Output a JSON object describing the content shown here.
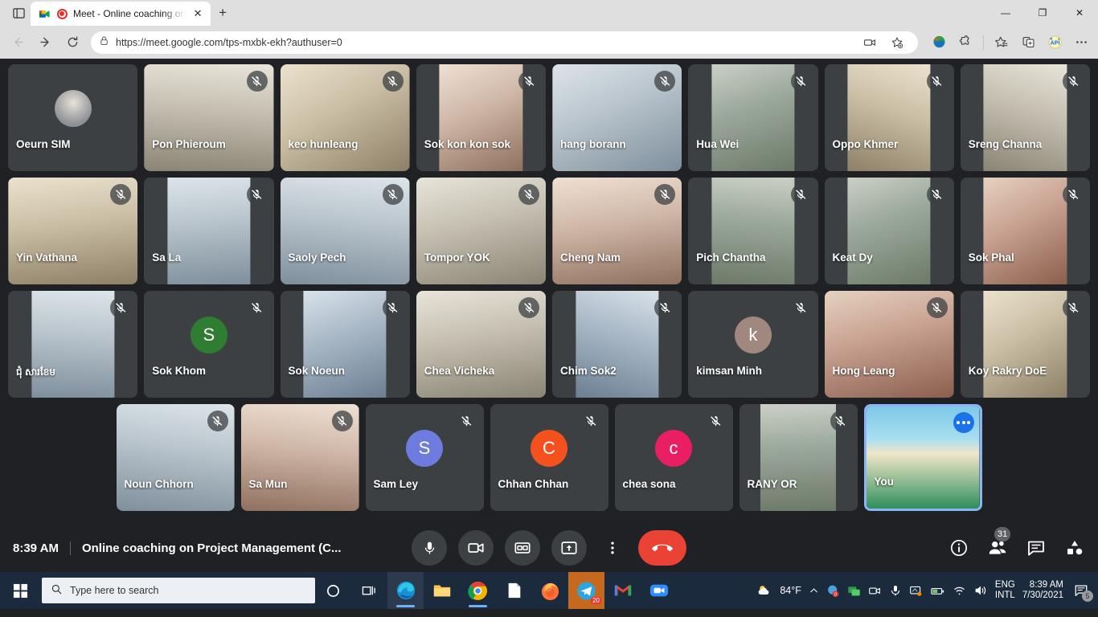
{
  "browser": {
    "tab": {
      "title": "Meet - Online coaching on",
      "favicon": "google-meet-icon",
      "recording": true,
      "close_label": "✕"
    },
    "new_tab_label": "+",
    "window_controls": {
      "minimize": "—",
      "maximize": "❐",
      "close": "✕"
    },
    "url": "https://meet.google.com/tps-mxbk-ekh?authuser=0",
    "nav": {
      "back": "back-icon",
      "forward": "forward-icon",
      "reload": "reload-icon"
    },
    "toolbar_icons": [
      "media-cast-icon",
      "add-favorite-icon",
      "globe-extension-icon",
      "puzzle-extension-icon",
      "collections-icon",
      "split-screen-icon",
      "api-extension-icon",
      "settings-more-icon"
    ]
  },
  "meet": {
    "time": "8:39 AM",
    "title": "Online coaching on Project Management (C...",
    "controls": [
      {
        "name": "microphone-button",
        "icon": "mic-icon"
      },
      {
        "name": "camera-button",
        "icon": "camera-icon"
      },
      {
        "name": "captions-button",
        "icon": "cc-icon"
      },
      {
        "name": "present-button",
        "icon": "present-screen-icon"
      },
      {
        "name": "more-options-button",
        "icon": "kebab-icon"
      },
      {
        "name": "leave-call-button",
        "icon": "hangup-icon"
      }
    ],
    "right_icons": [
      {
        "name": "meeting-details-button",
        "icon": "info-icon"
      },
      {
        "name": "participants-button",
        "icon": "people-icon",
        "badge": "31"
      },
      {
        "name": "chat-button",
        "icon": "chat-icon"
      },
      {
        "name": "activities-button",
        "icon": "activities-icon"
      }
    ],
    "participants": [
      {
        "name": "Oeurn SIM",
        "muted": false,
        "kind": "avatar-photo",
        "av": "#8d9096",
        "fit": ""
      },
      {
        "name": "Pon Phieroum",
        "muted": true,
        "kind": "video",
        "fit": "full"
      },
      {
        "name": "keo hunleang",
        "muted": true,
        "kind": "video",
        "fit": "full"
      },
      {
        "name": "Sok kon kon sok",
        "muted": true,
        "kind": "video",
        "fit": ""
      },
      {
        "name": "hang borann",
        "muted": true,
        "kind": "video",
        "fit": "full"
      },
      {
        "name": "Hua Wei",
        "muted": true,
        "kind": "video",
        "fit": ""
      },
      {
        "name": "Oppo Khmer",
        "muted": true,
        "kind": "video",
        "fit": ""
      },
      {
        "name": "Sreng Channa",
        "muted": true,
        "kind": "video",
        "fit": ""
      },
      {
        "name": "Yin Vathana",
        "muted": true,
        "kind": "video",
        "fit": "full"
      },
      {
        "name": "Sa La",
        "muted": true,
        "kind": "video",
        "fit": ""
      },
      {
        "name": "Saoly Pech",
        "muted": true,
        "kind": "video",
        "fit": "full"
      },
      {
        "name": "Tompor YOK",
        "muted": true,
        "kind": "video",
        "fit": "full"
      },
      {
        "name": "Cheng Nam",
        "muted": true,
        "kind": "video",
        "fit": "full"
      },
      {
        "name": "Pich Chantha",
        "muted": true,
        "kind": "video",
        "fit": ""
      },
      {
        "name": "Keat Dy",
        "muted": true,
        "kind": "video",
        "fit": ""
      },
      {
        "name": "Sok Phal",
        "muted": true,
        "kind": "video",
        "fit": ""
      },
      {
        "name": "ជុំ សារខែម",
        "muted": true,
        "kind": "video",
        "fit": "",
        "khmer": true
      },
      {
        "name": "Sok Khom",
        "muted": true,
        "kind": "avatar-letter",
        "letter": "S",
        "av": "#2e7d32"
      },
      {
        "name": "Sok Noeun",
        "muted": true,
        "kind": "video",
        "fit": ""
      },
      {
        "name": "Chea Vicheka",
        "muted": true,
        "kind": "video",
        "fit": "full"
      },
      {
        "name": "Chim Sok2",
        "muted": true,
        "kind": "video",
        "fit": ""
      },
      {
        "name": "kimsan Minh",
        "muted": true,
        "kind": "avatar-letter",
        "letter": "k",
        "av": "#a1887f"
      },
      {
        "name": "Hong Leang",
        "muted": true,
        "kind": "video",
        "fit": "full"
      },
      {
        "name": "Koy Rakry DoE",
        "muted": true,
        "kind": "video",
        "fit": ""
      }
    ],
    "participants_row4": [
      {
        "name": "Noun Chhorn",
        "muted": true,
        "kind": "video",
        "fit": "full"
      },
      {
        "name": "Sa Mun",
        "muted": true,
        "kind": "video",
        "fit": "full"
      },
      {
        "name": "Sam Ley",
        "muted": true,
        "kind": "avatar-letter",
        "letter": "S",
        "av": "#6e7ce0"
      },
      {
        "name": "Chhan Chhan",
        "muted": true,
        "kind": "avatar-letter",
        "letter": "C",
        "av": "#f4511e"
      },
      {
        "name": "chea sona",
        "muted": true,
        "kind": "avatar-letter",
        "letter": "c",
        "av": "#e91e63"
      },
      {
        "name": "RANY OR",
        "muted": true,
        "kind": "video",
        "fit": ""
      },
      {
        "name": "You",
        "muted": false,
        "kind": "video",
        "fit": "full",
        "self": true,
        "more_options": "more-options-icon"
      }
    ]
  },
  "taskbar": {
    "start": "windows-start-icon",
    "search_placeholder": "Type here to search",
    "icons": [
      "cortana-icon",
      "task-view-icon",
      "edge-icon",
      "file-explorer-icon",
      "chrome-icon",
      "document-icon",
      "firefox-icon",
      "telegram-icon",
      "gmail-icon",
      "zoom-icon"
    ],
    "telegram_badge": "20",
    "weather": "84°F",
    "tray": [
      "chevron-up-icon",
      "antivirus-icon",
      "network-monitor-icon",
      "camera-tray-icon",
      "mic-tray-icon",
      "display-icon",
      "battery-icon",
      "wifi-icon",
      "volume-icon"
    ],
    "language": {
      "line1": "ENG",
      "line2": "INTL"
    },
    "clock": {
      "time": "8:39 AM",
      "date": "7/30/2021"
    },
    "notification_count": "5"
  },
  "colors": {
    "accent": "#1a73e8",
    "hangup": "#ea4335",
    "self_border": "#8ab4f8",
    "stage_bg": "#202124",
    "tile_bg": "#3c4043",
    "taskbar_bg": "#1b2a3d"
  }
}
